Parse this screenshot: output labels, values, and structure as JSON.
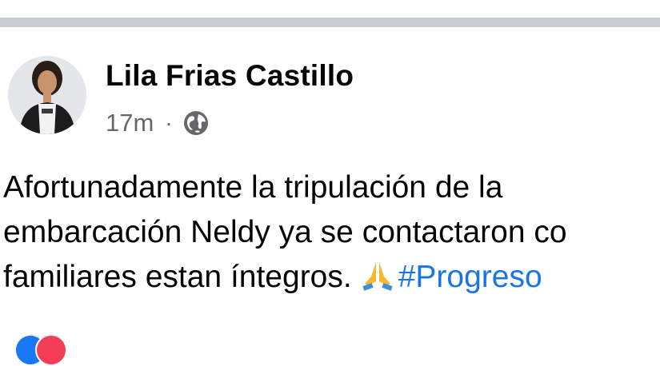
{
  "post": {
    "author": "Lila Frias Castillo",
    "time": "17m",
    "separator": "·",
    "audience_icon": "globe-icon",
    "lines": [
      "Afortunadamente la tripulación de la",
      "embarcación Neldy ya se contactaron co",
      "familiares estan íntegros."
    ],
    "emoji_icon": "praying-hands-icon",
    "hashtag": "#Progreso"
  },
  "reactions": {
    "icons": [
      "like-icon",
      "love-icon"
    ]
  },
  "colors": {
    "divider": "#c9ccd1",
    "meta_gray": "#65676b",
    "hashtag_blue": "#1b74e4",
    "like_blue": "#1877f2",
    "love_red": "#f33e58"
  }
}
